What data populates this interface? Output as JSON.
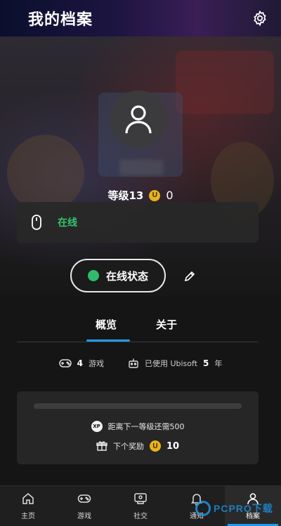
{
  "header": {
    "title": "我的档案",
    "settings_icon": "gear-icon"
  },
  "profile": {
    "avatar_icon": "user-icon",
    "level_label": "等级13",
    "coin_symbol": "U",
    "coin_value": "0"
  },
  "presence": {
    "status_text": "在线",
    "device_icon": "mouse-icon"
  },
  "status_button": {
    "label": "在线状态",
    "edit_icon": "pencil-icon",
    "dot_color": "#2fbb6a"
  },
  "tabs": [
    {
      "label": "概览",
      "active": true
    },
    {
      "label": "关于",
      "active": false
    }
  ],
  "stats": {
    "games_count": "4",
    "games_label": "游戏",
    "used_prefix": "已使用 Ubisoft",
    "years_count": "5",
    "years_label": "年"
  },
  "xp": {
    "badge": "XP",
    "progress": 0.0,
    "next_level_text": "距离下一等级还需500",
    "reward_label": "下个奖励",
    "reward_coin_symbol": "U",
    "reward_value": "10"
  },
  "nav": [
    {
      "label": "主页",
      "icon": "home-icon"
    },
    {
      "label": "游戏",
      "icon": "gamepad-icon"
    },
    {
      "label": "社交",
      "icon": "social-icon"
    },
    {
      "label": "通知",
      "icon": "bell-icon"
    },
    {
      "label": "档案",
      "icon": "profile-icon",
      "active": true
    }
  ],
  "watermark": {
    "text": "PCPRO下载"
  },
  "colors": {
    "accent": "#1d9bf0",
    "online": "#33c46b",
    "coin": "#e8b31a"
  }
}
